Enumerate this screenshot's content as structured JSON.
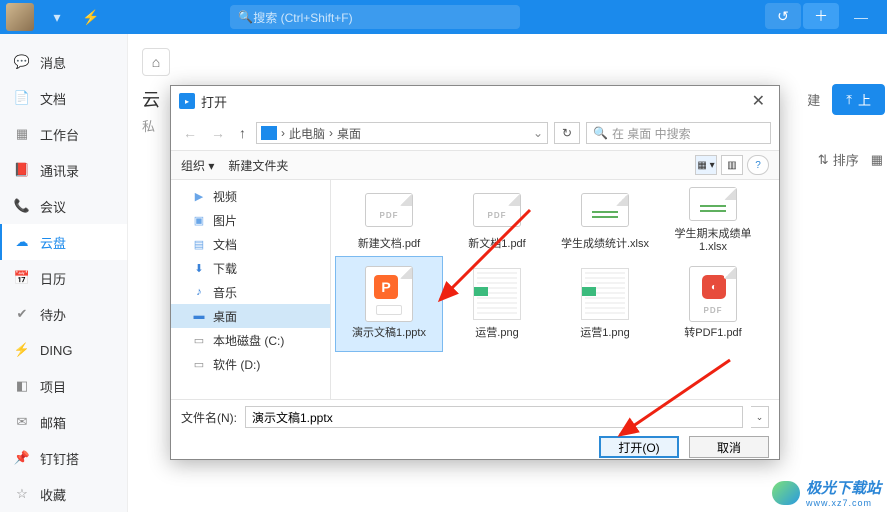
{
  "topbar": {
    "search_placeholder": "搜索 (Ctrl+Shift+F)"
  },
  "sidebar": {
    "items": [
      {
        "icon": "chat",
        "label": "消息"
      },
      {
        "icon": "doc",
        "label": "文档"
      },
      {
        "icon": "grid",
        "label": "工作台"
      },
      {
        "icon": "book",
        "label": "通讯录"
      },
      {
        "icon": "phone",
        "label": "会议"
      },
      {
        "icon": "cloud",
        "label": "云盘"
      },
      {
        "icon": "cal",
        "label": "日历"
      },
      {
        "icon": "check",
        "label": "待办"
      },
      {
        "icon": "bolt",
        "label": "DING"
      },
      {
        "icon": "proj",
        "label": "项目"
      },
      {
        "icon": "mail",
        "label": "邮箱"
      },
      {
        "icon": "pin",
        "label": "钉钉搭"
      },
      {
        "icon": "star",
        "label": "收藏"
      }
    ]
  },
  "content": {
    "title": "云",
    "subtitle": "私",
    "btn_new": "建",
    "btn_upload": "上",
    "sort_label": "排序"
  },
  "dialog": {
    "title": "打开",
    "path": {
      "seg1": "此电脑",
      "seg2": "桌面"
    },
    "search_placeholder": "在 桌面 中搜索",
    "organize": "组织",
    "newfolder": "新建文件夹",
    "tree": [
      {
        "icon": "video",
        "label": "视频",
        "color": "#6aa6e8"
      },
      {
        "icon": "image",
        "label": "图片",
        "color": "#6aa6e8"
      },
      {
        "icon": "doc",
        "label": "文档",
        "color": "#6aa6e8"
      },
      {
        "icon": "down",
        "label": "下载",
        "color": "#3a82d8"
      },
      {
        "icon": "music",
        "label": "音乐",
        "color": "#3a82d8"
      },
      {
        "icon": "desk",
        "label": "桌面",
        "color": "#3a82d8",
        "selected": true
      },
      {
        "icon": "disk",
        "label": "本地磁盘 (C:)",
        "color": "#888"
      },
      {
        "icon": "disk",
        "label": "软件 (D:)",
        "color": "#888"
      }
    ],
    "files_row1": [
      {
        "type": "pdf",
        "label": "新建文档.pdf"
      },
      {
        "type": "pdf",
        "label": "新文档1.pdf"
      },
      {
        "type": "xlsx",
        "label": "学生成绩统计.xlsx"
      },
      {
        "type": "xlsx",
        "label": "学生期末成绩单1.xlsx"
      }
    ],
    "files_row2": [
      {
        "type": "pptx",
        "label": "演示文稿1.pptx",
        "selected": true
      },
      {
        "type": "png",
        "label": "运营.png"
      },
      {
        "type": "png",
        "label": "运营1.png"
      },
      {
        "type": "pdfred",
        "label": "转PDF1.pdf"
      }
    ],
    "filename_label": "文件名(N):",
    "filename_value": "演示文稿1.pptx",
    "btn_open": "打开(O)",
    "btn_cancel": "取消"
  },
  "branding": {
    "name": "极光下载站",
    "url": "www.xz7.com"
  }
}
